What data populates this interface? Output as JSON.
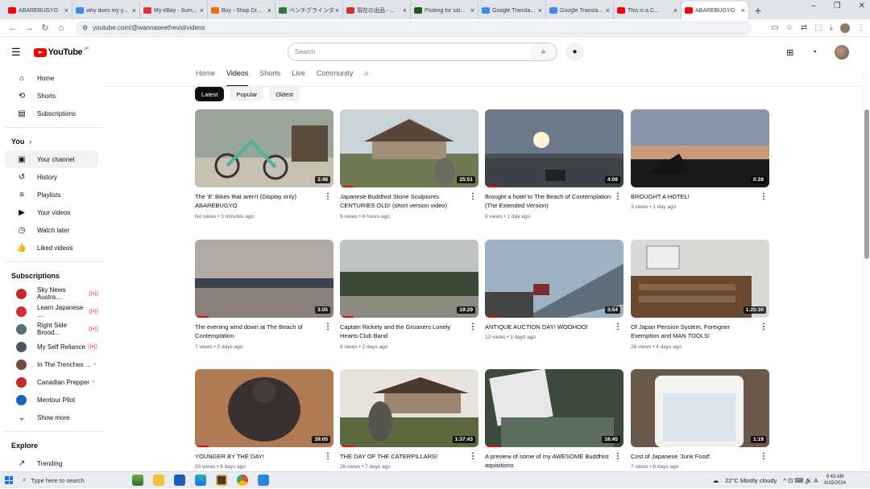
{
  "browser": {
    "tabs": [
      {
        "label": "ABAREBUGYO",
        "color": "#ff0000"
      },
      {
        "label": "why does my y...",
        "color": "#4285f4"
      },
      {
        "label": "My eBay - Sum...",
        "color": "#e53238"
      },
      {
        "label": "Buy - Shop Dr...",
        "color": "#e8710a"
      },
      {
        "label": "ベンチグラインダー",
        "color": "#2e7d32"
      },
      {
        "label": "現在の出品 - ...",
        "color": "#d32f2f"
      },
      {
        "label": "Posting for sal...",
        "color": "#1b5e20"
      },
      {
        "label": "Google Transla...",
        "color": "#4285f4"
      },
      {
        "label": "Google Transla...",
        "color": "#4285f4"
      },
      {
        "label": "This is a C...",
        "color": "#ff0000"
      },
      {
        "label": "ABAREBUGYO",
        "color": "#ff0000",
        "active": true
      }
    ],
    "new_tab": "+",
    "url": "youtube.com/@wannaseethevid/videos",
    "window_controls": [
      "⌄",
      "–",
      "❐",
      "✕"
    ]
  },
  "header": {
    "menu_icon": "☰",
    "logo_text": "YouTube",
    "logo_sup": "JP",
    "search_placeholder": "Search",
    "search_icon": "⌕",
    "mic_icon": "🎤",
    "create_icon": "⊞",
    "bell_icon": "🔔"
  },
  "sidebar": {
    "main": [
      {
        "label": "Home",
        "icon": "⌂"
      },
      {
        "label": "Shorts",
        "icon": "⟲"
      },
      {
        "label": "Subscriptions",
        "icon": "▤"
      }
    ],
    "you_heading": "You",
    "you_chevron": "›",
    "you_items": [
      {
        "label": "Your channel",
        "icon": "▣",
        "active": true
      },
      {
        "label": "History",
        "icon": "↺"
      },
      {
        "label": "Playlists",
        "icon": "≡"
      },
      {
        "label": "Your videos",
        "icon": "▶"
      },
      {
        "label": "Watch later",
        "icon": "◷"
      },
      {
        "label": "Liked videos",
        "icon": "👍"
      }
    ],
    "subs_heading": "Subscriptions",
    "subscriptions": [
      {
        "label": "Sky News Austra...",
        "color": "#c62828",
        "badge": "((•))"
      },
      {
        "label": "Learn Japanese ...",
        "color": "#d32f2f",
        "badge": "((•))"
      },
      {
        "label": "Right Side Brood...",
        "color": "#546e7a",
        "badge": "((•))"
      },
      {
        "label": "My Self Reliance",
        "color": "#455a64",
        "badge": "((•))"
      },
      {
        "label": "In The Trenches ...",
        "color": "#6d4c41",
        "badge": "•"
      },
      {
        "label": "Canadian Prepper",
        "color": "#c62828",
        "badge": "•"
      },
      {
        "label": "Mentour Pilot",
        "color": "#1565c0",
        "badge": ""
      }
    ],
    "show_more": "Show more",
    "explore_heading": "Explore",
    "explore_items": [
      {
        "label": "Trending",
        "icon": "↗"
      }
    ]
  },
  "channel_tabs": [
    "Home",
    "Videos",
    "Shorts",
    "Live",
    "Community"
  ],
  "active_tab": "Videos",
  "chips": [
    "Latest",
    "Popular",
    "Oldest"
  ],
  "videos": [
    {
      "title": "The 'E' Bikes that aren't (Display only) ABAREBUGYO",
      "meta": "No views • 3 minutes ago",
      "duration": "3:48",
      "progress": 0
    },
    {
      "title": "Japanese Buddhist Stone Sculptures CENTURIES OLD! (short version video)",
      "meta": "6 views • 6 hours ago",
      "duration": "25:51",
      "progress": 0.1
    },
    {
      "title": "Brought a hotel to The Beach of Contemplation (The Extended Version)",
      "meta": "9 views • 1 day ago",
      "duration": "4:08",
      "progress": 0.1
    },
    {
      "title": "BROUGHT A HOTEL!",
      "meta": "3 views • 1 day ago",
      "duration": "0:28",
      "progress": 0
    },
    {
      "title": "The evening wind down at The Beach of Contemplation",
      "meta": "7 views • 2 days ago",
      "duration": "3:05",
      "progress": 0.1
    },
    {
      "title": "Captain Rickety and the Groaners Lonely Hearts Club Band",
      "meta": "8 views • 2 days ago",
      "duration": "19:29",
      "progress": 0.1
    },
    {
      "title": "ANTIQUE AUCTION DAY! WOOHOO!",
      "meta": "12 views • 3 days ago",
      "duration": "3:54",
      "progress": 0.1
    },
    {
      "title": "Of Japan Pension System, Foreigner Exemption and MAN TOOLS!",
      "meta": "26 views • 4 days ago",
      "duration": "1:25:30",
      "progress": 0.05
    },
    {
      "title": "YOUNGER BY THE DAY!",
      "meta": "33 views • 6 days ago",
      "duration": "39:05",
      "progress": 0.1
    },
    {
      "title": "THE DAY OF THE CATERPILLARS!",
      "meta": "26 views • 7 days ago",
      "duration": "1:37:43",
      "progress": 0.1
    },
    {
      "title": "A preview of some of my AWESOME Buddhist aquisitions",
      "meta": "",
      "duration": "16:45",
      "progress": 0.1
    },
    {
      "title": "Cost of Japanese 'Junk Food'.",
      "meta": "7 views • 8 days ago",
      "duration": "1:19",
      "progress": 0
    }
  ],
  "taskbar": {
    "search_placeholder": "Type here to search",
    "weather": "22°C  Mostly cloudy",
    "time": "9:43 AM",
    "date": "6/15/2024",
    "tray_icons": "^ ⊡ ⌨ 🔊 A"
  }
}
